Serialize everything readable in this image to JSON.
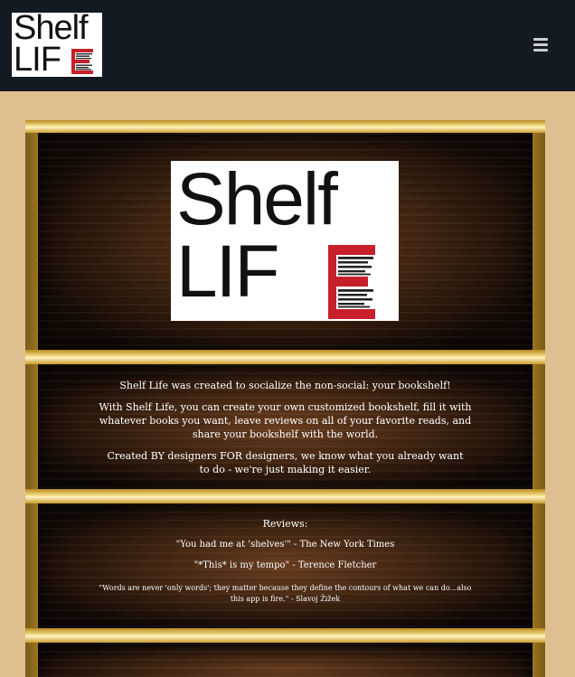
{
  "nav": {
    "logo": {
      "word1": "Shelf",
      "word2": "LIF"
    },
    "menu_icon": "hamburger-menu-icon"
  },
  "hero": {
    "logo": {
      "word1": "Shelf",
      "word2": "LIF"
    }
  },
  "about": {
    "intro": "Shelf Life was created to socialize the non-social: your bookshelf!",
    "p1_line1": "With Shelf Life, you can create your own customized bookshelf, fill it with",
    "p1_line2": "whatever books you want, leave reviews on all of your favorite reads, and",
    "p1_line3": "share your bookshelf with the world.",
    "p2_line1": "Created BY designers FOR designers, we know what you already want",
    "p2_line2": "to do - we're just making it easier."
  },
  "reviews": {
    "heading": "Reviews:",
    "items": [
      "\"You had me at 'shelves'\" - The New York Times",
      "\"*This* is my tempo\" - Terence Fletcher"
    ],
    "quote3_line1": "\"Words are never 'only words'; they matter because they define the contours of what we can do...also",
    "quote3_line2": "this app is fire.\" - Slavoj Žižek"
  },
  "colors": {
    "navbar": "#131a22",
    "page_bg": "#dfbf90",
    "gold": "#e8c560",
    "wood": "#3c2210",
    "logo_red": "#c8202a"
  }
}
